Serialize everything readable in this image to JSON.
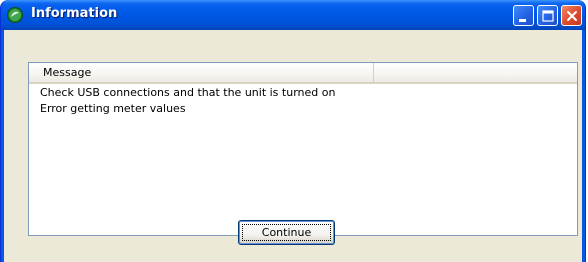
{
  "window": {
    "title": "Information",
    "icon": "green-leaf-app-icon",
    "controls": {
      "minimize": "minimize-icon",
      "maximize": "maximize-icon",
      "close": "close-icon"
    }
  },
  "list": {
    "columns": [
      "Message",
      ""
    ],
    "rows": [
      "Check USB connections and that the unit is turned on",
      "Error getting meter values"
    ]
  },
  "buttons": {
    "continue_label": "Continue"
  },
  "colors": {
    "titlebar": "#0058e6",
    "client_bg": "#ece9d8",
    "close_button": "#dc4a2c"
  }
}
